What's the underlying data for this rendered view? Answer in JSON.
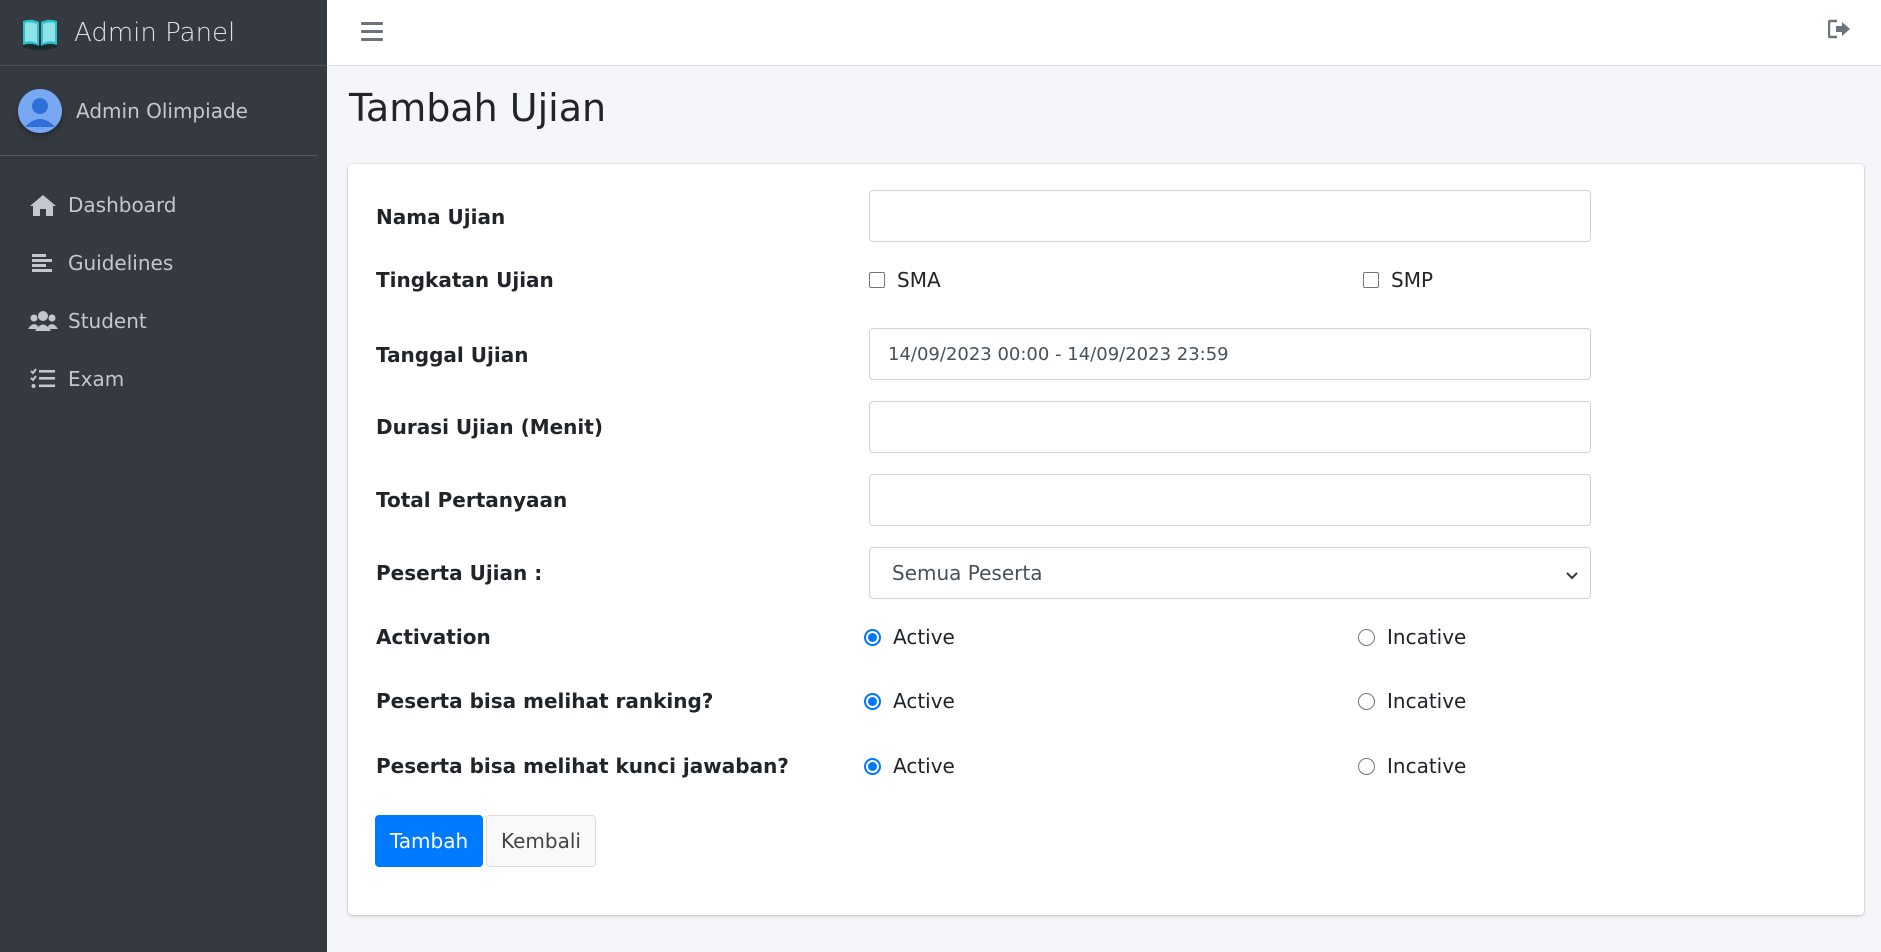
{
  "app": {
    "brand": "Admin Panel",
    "user_name": "Admin Olimpiade"
  },
  "sidebar": {
    "items": [
      {
        "label": "Dashboard",
        "icon": "home-icon"
      },
      {
        "label": "Guidelines",
        "icon": "align-left-icon"
      },
      {
        "label": "Student",
        "icon": "users-icon"
      },
      {
        "label": "Exam",
        "icon": "list-check-icon"
      }
    ]
  },
  "header": {
    "menu_icon": "hamburger-icon",
    "logout_icon": "sign-out-icon"
  },
  "page": {
    "title": "Tambah Ujian"
  },
  "form": {
    "nama_ujian": {
      "label": "Nama Ujian",
      "value": ""
    },
    "tingkatan": {
      "label": "Tingkatan Ujian",
      "options": [
        {
          "label": "SMA",
          "checked": false
        },
        {
          "label": "SMP",
          "checked": false
        }
      ]
    },
    "tanggal": {
      "label": "Tanggal Ujian",
      "value": "14/09/2023 00:00 - 14/09/2023 23:59"
    },
    "durasi": {
      "label": "Durasi Ujian (Menit)",
      "value": ""
    },
    "total": {
      "label": "Total Pertanyaan",
      "value": ""
    },
    "peserta": {
      "label": "Peserta Ujian :",
      "selected": "Semua Peserta"
    },
    "activation": {
      "label": "Activation",
      "options": [
        "Active",
        "Incative"
      ],
      "selected": "Active"
    },
    "ranking": {
      "label": "Peserta bisa melihat ranking?",
      "options": [
        "Active",
        "Incative"
      ],
      "selected": "Active"
    },
    "kunci": {
      "label": "Peserta bisa melihat kunci jawaban?",
      "options": [
        "Active",
        "Incative"
      ],
      "selected": "Active"
    },
    "submit_label": "Tambah",
    "back_label": "Kembali"
  },
  "colors": {
    "sidebar_bg": "#343a40",
    "primary": "#007bff",
    "page_bg": "#f4f6f9"
  }
}
